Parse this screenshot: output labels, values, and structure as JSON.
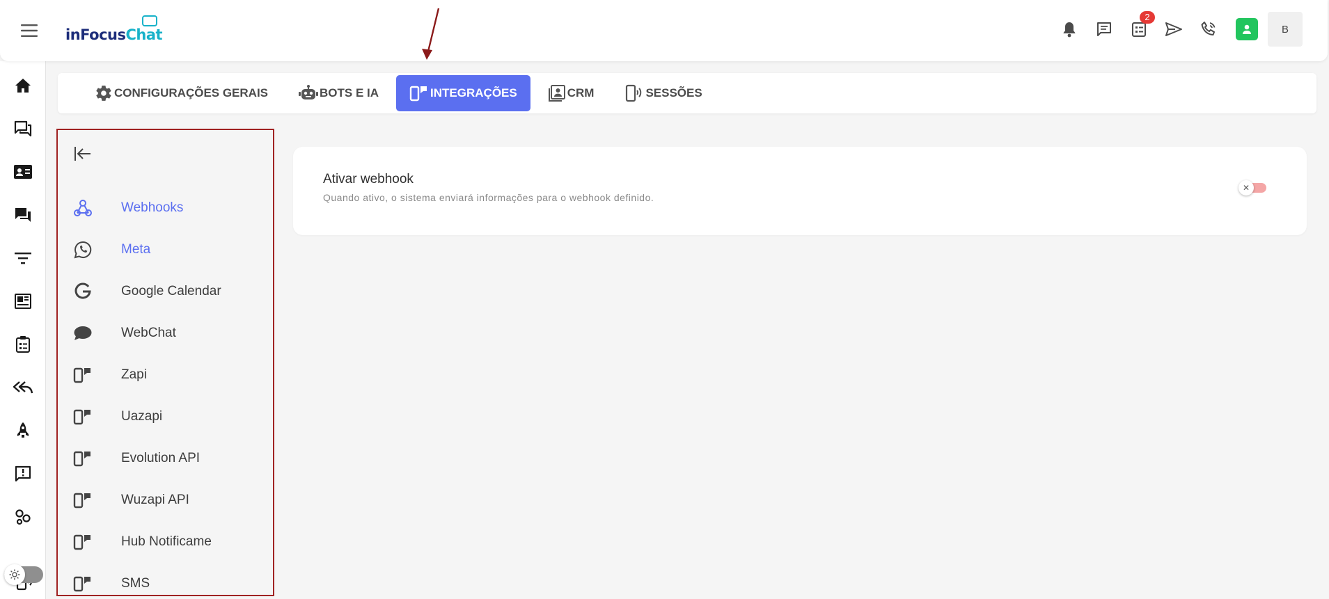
{
  "app": {
    "logo_text_a": "inFocus",
    "logo_text_b": "Chat"
  },
  "topbar": {
    "icons": [
      "bell-icon",
      "chat-icon",
      "checklist-icon",
      "send-icon",
      "phone-icon"
    ],
    "checklist_badge": "2",
    "avatar_initial": "B"
  },
  "rail": {
    "icons": [
      "home-icon",
      "forum-icon",
      "contact-card-icon",
      "chat-bubbles-icon",
      "filter-icon",
      "dashboard-icon",
      "clipboard-icon",
      "reply-all-icon",
      "rocket-icon",
      "review-icon",
      "groups-icon",
      "sessions-icon"
    ]
  },
  "tabs": [
    {
      "label": "CONFIGURAÇÕES GERAIS",
      "icon": "gear-icon"
    },
    {
      "label": "BOTS E IA",
      "icon": "robot-icon"
    },
    {
      "label": "INTEGRAÇÕES",
      "icon": "devices-icon"
    },
    {
      "label": "CRM",
      "icon": "contacts-icon"
    },
    {
      "label": "SESSÕES",
      "icon": "phone-signal-icon"
    }
  ],
  "sidebar": {
    "items": [
      {
        "label": "Webhooks",
        "icon": "webhook-icon"
      },
      {
        "label": "Meta",
        "icon": "whatsapp-icon"
      },
      {
        "label": "Google Calendar",
        "icon": "google-icon"
      },
      {
        "label": "WebChat",
        "icon": "chat-bubble-icon"
      },
      {
        "label": "Zapi",
        "icon": "devices-icon"
      },
      {
        "label": "Uazapi",
        "icon": "devices-icon"
      },
      {
        "label": "Evolution API",
        "icon": "devices-icon"
      },
      {
        "label": "Wuzapi API",
        "icon": "devices-icon"
      },
      {
        "label": "Hub Notificame",
        "icon": "devices-icon"
      },
      {
        "label": "SMS",
        "icon": "devices-icon"
      }
    ]
  },
  "webhook_card": {
    "title": "Ativar webhook",
    "description": "Quando ativo, o sistema enviará informações para o webhook definido.",
    "toggle_enabled": false,
    "toggle_color": "#f4a6a6"
  },
  "colors": {
    "accent": "#5b6ff0",
    "green": "#22c55e",
    "badge": "#e53935",
    "highlight_border": "#a02222"
  }
}
